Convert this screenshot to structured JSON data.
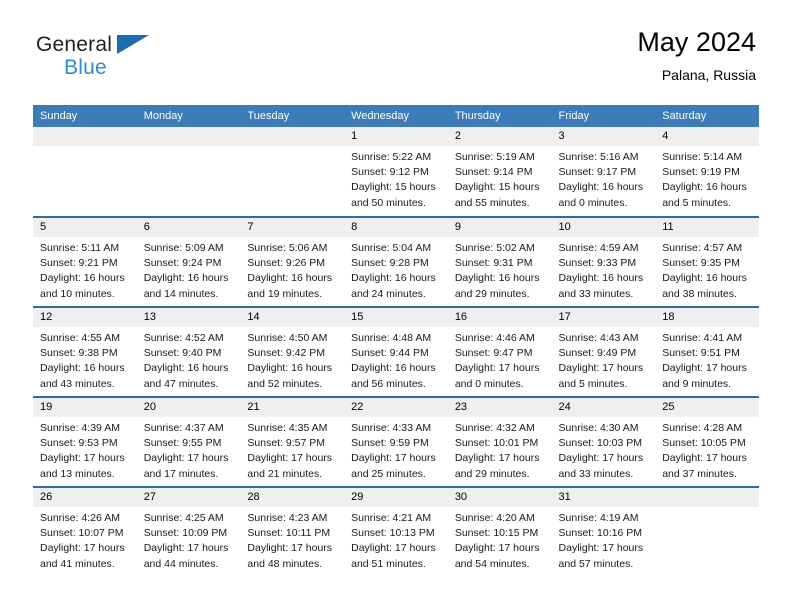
{
  "brand": {
    "line1": "General",
    "line2": "Blue",
    "accent_blue": "#1b6cb5",
    "accent_light_blue": "#2e8bd4"
  },
  "header": {
    "title": "May 2024",
    "location": "Palana, Russia"
  },
  "theme": {
    "header_bg": "#3b7cb9",
    "week_divider": "#2e6ca4",
    "daynum_bg": "#efefef"
  },
  "labels": {
    "sunrise": "Sunrise:",
    "sunset": "Sunset:",
    "daylight": "Daylight:"
  },
  "weekdays": [
    "Sunday",
    "Monday",
    "Tuesday",
    "Wednesday",
    "Thursday",
    "Friday",
    "Saturday"
  ],
  "weeks": [
    [
      {
        "day": "",
        "empty": true
      },
      {
        "day": "",
        "empty": true
      },
      {
        "day": "",
        "empty": true
      },
      {
        "day": "1",
        "sunrise": "Sunrise: 5:22 AM",
        "sunset": "Sunset: 9:12 PM",
        "daylight1": "Daylight: 15 hours",
        "daylight2": "and 50 minutes."
      },
      {
        "day": "2",
        "sunrise": "Sunrise: 5:19 AM",
        "sunset": "Sunset: 9:14 PM",
        "daylight1": "Daylight: 15 hours",
        "daylight2": "and 55 minutes."
      },
      {
        "day": "3",
        "sunrise": "Sunrise: 5:16 AM",
        "sunset": "Sunset: 9:17 PM",
        "daylight1": "Daylight: 16 hours",
        "daylight2": "and 0 minutes."
      },
      {
        "day": "4",
        "sunrise": "Sunrise: 5:14 AM",
        "sunset": "Sunset: 9:19 PM",
        "daylight1": "Daylight: 16 hours",
        "daylight2": "and 5 minutes."
      }
    ],
    [
      {
        "day": "5",
        "sunrise": "Sunrise: 5:11 AM",
        "sunset": "Sunset: 9:21 PM",
        "daylight1": "Daylight: 16 hours",
        "daylight2": "and 10 minutes."
      },
      {
        "day": "6",
        "sunrise": "Sunrise: 5:09 AM",
        "sunset": "Sunset: 9:24 PM",
        "daylight1": "Daylight: 16 hours",
        "daylight2": "and 14 minutes."
      },
      {
        "day": "7",
        "sunrise": "Sunrise: 5:06 AM",
        "sunset": "Sunset: 9:26 PM",
        "daylight1": "Daylight: 16 hours",
        "daylight2": "and 19 minutes."
      },
      {
        "day": "8",
        "sunrise": "Sunrise: 5:04 AM",
        "sunset": "Sunset: 9:28 PM",
        "daylight1": "Daylight: 16 hours",
        "daylight2": "and 24 minutes."
      },
      {
        "day": "9",
        "sunrise": "Sunrise: 5:02 AM",
        "sunset": "Sunset: 9:31 PM",
        "daylight1": "Daylight: 16 hours",
        "daylight2": "and 29 minutes."
      },
      {
        "day": "10",
        "sunrise": "Sunrise: 4:59 AM",
        "sunset": "Sunset: 9:33 PM",
        "daylight1": "Daylight: 16 hours",
        "daylight2": "and 33 minutes."
      },
      {
        "day": "11",
        "sunrise": "Sunrise: 4:57 AM",
        "sunset": "Sunset: 9:35 PM",
        "daylight1": "Daylight: 16 hours",
        "daylight2": "and 38 minutes."
      }
    ],
    [
      {
        "day": "12",
        "sunrise": "Sunrise: 4:55 AM",
        "sunset": "Sunset: 9:38 PM",
        "daylight1": "Daylight: 16 hours",
        "daylight2": "and 43 minutes."
      },
      {
        "day": "13",
        "sunrise": "Sunrise: 4:52 AM",
        "sunset": "Sunset: 9:40 PM",
        "daylight1": "Daylight: 16 hours",
        "daylight2": "and 47 minutes."
      },
      {
        "day": "14",
        "sunrise": "Sunrise: 4:50 AM",
        "sunset": "Sunset: 9:42 PM",
        "daylight1": "Daylight: 16 hours",
        "daylight2": "and 52 minutes."
      },
      {
        "day": "15",
        "sunrise": "Sunrise: 4:48 AM",
        "sunset": "Sunset: 9:44 PM",
        "daylight1": "Daylight: 16 hours",
        "daylight2": "and 56 minutes."
      },
      {
        "day": "16",
        "sunrise": "Sunrise: 4:46 AM",
        "sunset": "Sunset: 9:47 PM",
        "daylight1": "Daylight: 17 hours",
        "daylight2": "and 0 minutes."
      },
      {
        "day": "17",
        "sunrise": "Sunrise: 4:43 AM",
        "sunset": "Sunset: 9:49 PM",
        "daylight1": "Daylight: 17 hours",
        "daylight2": "and 5 minutes."
      },
      {
        "day": "18",
        "sunrise": "Sunrise: 4:41 AM",
        "sunset": "Sunset: 9:51 PM",
        "daylight1": "Daylight: 17 hours",
        "daylight2": "and 9 minutes."
      }
    ],
    [
      {
        "day": "19",
        "sunrise": "Sunrise: 4:39 AM",
        "sunset": "Sunset: 9:53 PM",
        "daylight1": "Daylight: 17 hours",
        "daylight2": "and 13 minutes."
      },
      {
        "day": "20",
        "sunrise": "Sunrise: 4:37 AM",
        "sunset": "Sunset: 9:55 PM",
        "daylight1": "Daylight: 17 hours",
        "daylight2": "and 17 minutes."
      },
      {
        "day": "21",
        "sunrise": "Sunrise: 4:35 AM",
        "sunset": "Sunset: 9:57 PM",
        "daylight1": "Daylight: 17 hours",
        "daylight2": "and 21 minutes."
      },
      {
        "day": "22",
        "sunrise": "Sunrise: 4:33 AM",
        "sunset": "Sunset: 9:59 PM",
        "daylight1": "Daylight: 17 hours",
        "daylight2": "and 25 minutes."
      },
      {
        "day": "23",
        "sunrise": "Sunrise: 4:32 AM",
        "sunset": "Sunset: 10:01 PM",
        "daylight1": "Daylight: 17 hours",
        "daylight2": "and 29 minutes."
      },
      {
        "day": "24",
        "sunrise": "Sunrise: 4:30 AM",
        "sunset": "Sunset: 10:03 PM",
        "daylight1": "Daylight: 17 hours",
        "daylight2": "and 33 minutes."
      },
      {
        "day": "25",
        "sunrise": "Sunrise: 4:28 AM",
        "sunset": "Sunset: 10:05 PM",
        "daylight1": "Daylight: 17 hours",
        "daylight2": "and 37 minutes."
      }
    ],
    [
      {
        "day": "26",
        "sunrise": "Sunrise: 4:26 AM",
        "sunset": "Sunset: 10:07 PM",
        "daylight1": "Daylight: 17 hours",
        "daylight2": "and 41 minutes."
      },
      {
        "day": "27",
        "sunrise": "Sunrise: 4:25 AM",
        "sunset": "Sunset: 10:09 PM",
        "daylight1": "Daylight: 17 hours",
        "daylight2": "and 44 minutes."
      },
      {
        "day": "28",
        "sunrise": "Sunrise: 4:23 AM",
        "sunset": "Sunset: 10:11 PM",
        "daylight1": "Daylight: 17 hours",
        "daylight2": "and 48 minutes."
      },
      {
        "day": "29",
        "sunrise": "Sunrise: 4:21 AM",
        "sunset": "Sunset: 10:13 PM",
        "daylight1": "Daylight: 17 hours",
        "daylight2": "and 51 minutes."
      },
      {
        "day": "30",
        "sunrise": "Sunrise: 4:20 AM",
        "sunset": "Sunset: 10:15 PM",
        "daylight1": "Daylight: 17 hours",
        "daylight2": "and 54 minutes."
      },
      {
        "day": "31",
        "sunrise": "Sunrise: 4:19 AM",
        "sunset": "Sunset: 10:16 PM",
        "daylight1": "Daylight: 17 hours",
        "daylight2": "and 57 minutes."
      },
      {
        "day": "",
        "empty": true
      }
    ]
  ]
}
